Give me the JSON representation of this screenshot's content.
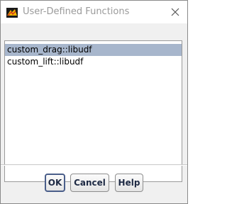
{
  "window": {
    "title": "User-Defined Functions",
    "icon": "ansys-fluent-icon",
    "close_icon": "close-icon"
  },
  "list": {
    "items": [
      {
        "label": "custom_drag::libudf",
        "selected": true
      },
      {
        "label": "custom_lift::libudf",
        "selected": false
      }
    ]
  },
  "buttons": {
    "ok": "OK",
    "cancel": "Cancel",
    "help": "Help"
  },
  "colors": {
    "selection": "#a7b6cc",
    "button_text": "#1e2a44",
    "dialog_bg": "#f0f0f0"
  }
}
